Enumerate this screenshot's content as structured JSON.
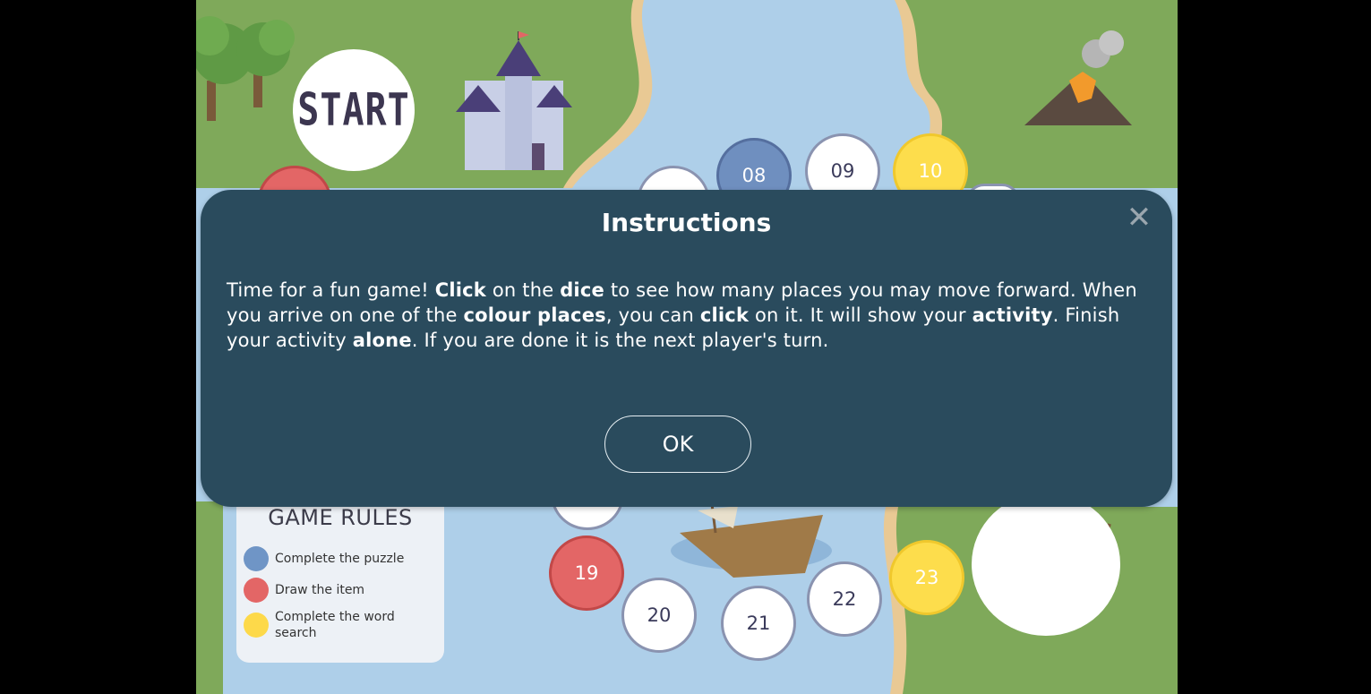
{
  "board": {
    "start_label": "START",
    "spaces": [
      {
        "label": "",
        "color": "red"
      },
      {
        "label": "",
        "color": "white"
      },
      {
        "label": "08",
        "color": "blue"
      },
      {
        "label": "09",
        "color": "white"
      },
      {
        "label": "10",
        "color": "yellow"
      },
      {
        "label": "",
        "color": "white"
      },
      {
        "label": "",
        "color": "white"
      },
      {
        "label": "19",
        "color": "red"
      },
      {
        "label": "20",
        "color": "white"
      },
      {
        "label": "21",
        "color": "white"
      },
      {
        "label": "22",
        "color": "white"
      },
      {
        "label": "23",
        "color": "yellow"
      }
    ]
  },
  "rules": {
    "title": "GAME RULES",
    "items": [
      {
        "text": "Complete the puzzle",
        "color": "#6f95c6"
      },
      {
        "text": "Draw the item",
        "color": "#e36666"
      },
      {
        "text": "Complete the word search",
        "color": "#fdd94a"
      }
    ]
  },
  "modal": {
    "title": "Instructions",
    "close_symbol": "✕",
    "body": [
      {
        "t": "Time for a fun game! ",
        "b": false
      },
      {
        "t": "Click",
        "b": true
      },
      {
        "t": " on the ",
        "b": false
      },
      {
        "t": "dice",
        "b": true
      },
      {
        "t": " to see how many places you may move forward. When you arrive on one of the ",
        "b": false
      },
      {
        "t": "colour places",
        "b": true
      },
      {
        "t": ", you can ",
        "b": false
      },
      {
        "t": "click",
        "b": true
      },
      {
        "t": " on it. It will show your ",
        "b": false
      },
      {
        "t": "activity",
        "b": true
      },
      {
        "t": ". Finish your activity ",
        "b": false
      },
      {
        "t": "alone",
        "b": true
      },
      {
        "t": ". If you are done it is the next player's turn.",
        "b": false
      }
    ],
    "ok_label": "OK"
  },
  "colors": {
    "modal_bg": "#2a4b5d",
    "water": "#aecfe9",
    "land": "#7fa95a",
    "sand": "#e9c994"
  }
}
